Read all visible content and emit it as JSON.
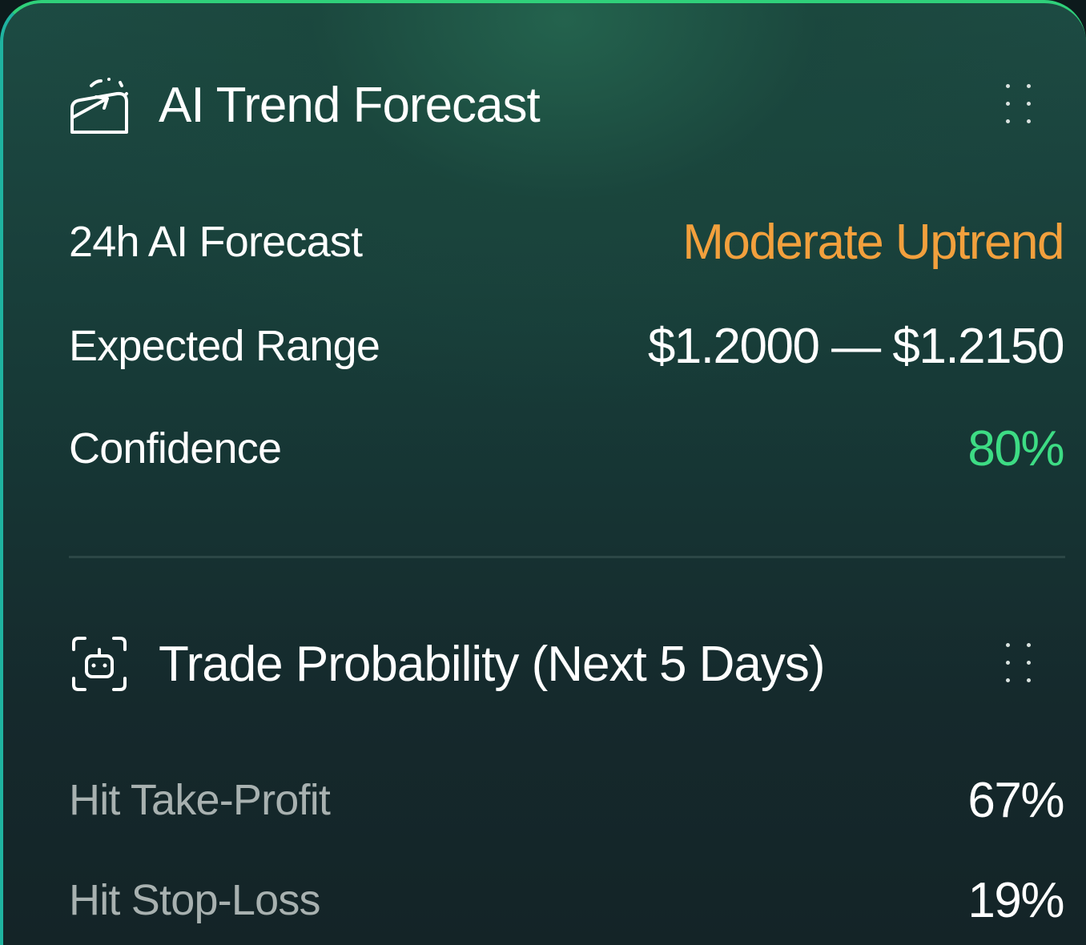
{
  "forecast": {
    "title": "AI Trend Forecast",
    "icon": "ai-trend-icon",
    "menu_icon": "more-vertical-icon",
    "rows": [
      {
        "label": "24h AI Forecast",
        "value": "Moderate Uptrend",
        "value_color": "#f2a03d"
      },
      {
        "label": "Expected Range",
        "value": "$1.2000 — $1.2150",
        "value_color": "#ffffff"
      },
      {
        "label": "Confidence",
        "value": "80%",
        "value_color": "#3ddc84"
      }
    ]
  },
  "probability": {
    "title": "Trade Probability (Next 5 Days)",
    "icon": "robot-scan-icon",
    "menu_icon": "more-vertical-icon",
    "rows": [
      {
        "label": "Hit Take-Profit",
        "value": "67%"
      },
      {
        "label": "Hit Stop-Loss",
        "value": "19%"
      }
    ]
  },
  "colors": {
    "accent_green": "#3ddc84",
    "accent_orange": "#f2a03d",
    "border_gradient": [
      "#2fd07a",
      "#1aa7c8"
    ]
  }
}
